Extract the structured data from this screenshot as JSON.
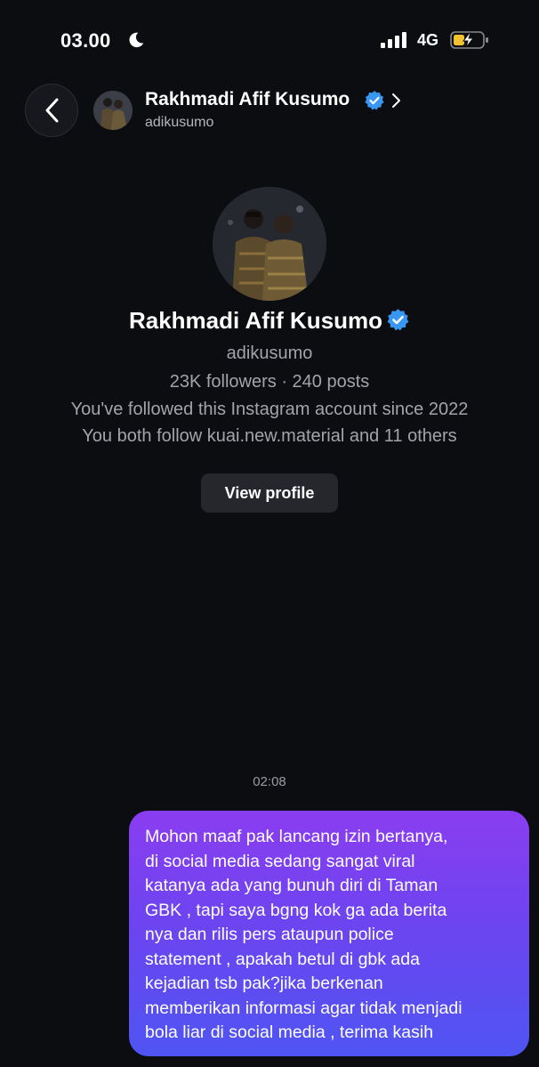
{
  "status_bar": {
    "time": "03.00",
    "network": "4G",
    "moon_icon": "moon-icon",
    "signal_icon": "cellular-signal-icon",
    "battery_icon": "battery-charging-icon"
  },
  "header": {
    "back_icon": "chevron-left-icon",
    "name": "Rakhmadi Afif Kusumo",
    "handle": "adikusumo",
    "verified_icon": "verified-badge-icon",
    "chevron_icon": "chevron-right-icon"
  },
  "profile": {
    "name": "Rakhmadi Afif Kusumo",
    "handle": "adikusumo",
    "stats": "23K followers · 240 posts",
    "followed_since": "You've followed this Instagram account since 2022",
    "mutuals": "You both follow kuai.new.material and 11 others",
    "view_profile_label": "View profile"
  },
  "chat": {
    "timestamp": "02:08",
    "message_lines": [
      "Mohon maaf pak lancang izin bertanya,",
      "di social media sedang sangat viral",
      "katanya ada yang bunuh diri di Taman",
      "GBK , tapi saya bgng kok ga ada berita",
      "nya dan rilis pers ataupun police",
      "statement , apakah betul di gbk ada",
      "kejadian tsb pak?jika berkenan",
      "memberikan informasi agar tidak menjadi",
      "bola liar di social media , terima kasih"
    ]
  },
  "colors": {
    "background": "#0c0d11",
    "verified": "#3897f0",
    "bubble_top": "#8a3df0",
    "bubble_bottom": "#4f55f2",
    "muted_text": "#a2a4aa"
  }
}
